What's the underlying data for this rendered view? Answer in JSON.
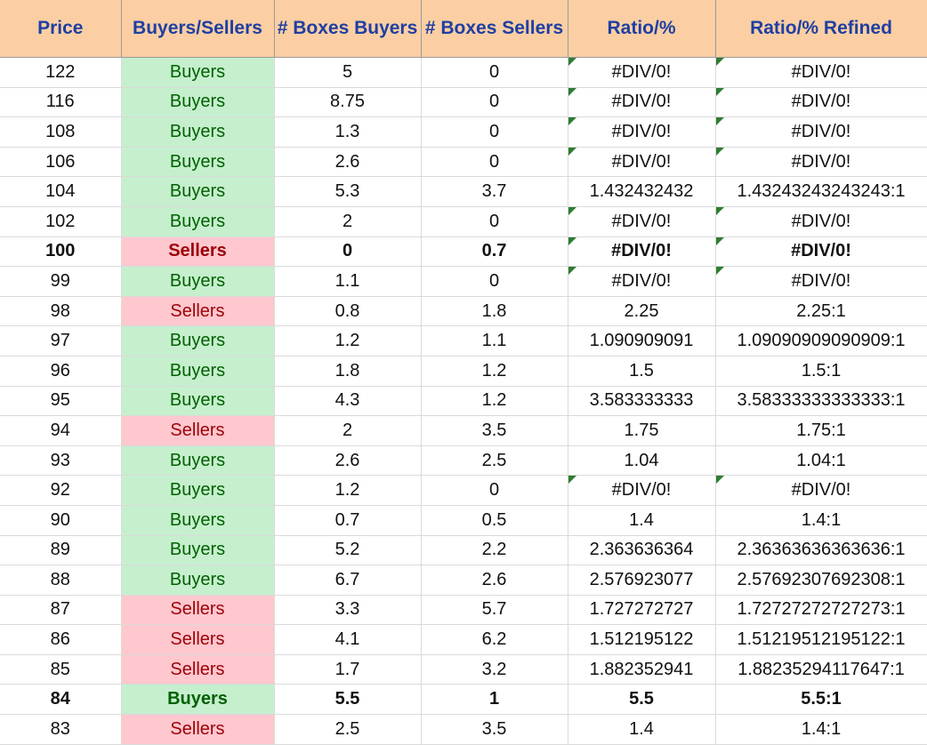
{
  "columns": [
    "Price",
    "Buyers/Sellers",
    "# Boxes Buyers",
    "# Boxes Sellers",
    "Ratio/%",
    "Ratio/% Refined"
  ],
  "colors": {
    "header_bg": "#fbcfa3",
    "header_text": "#1f3fa3",
    "buyers_bg": "#c6efce",
    "buyers_text": "#006100",
    "sellers_bg": "#ffc7ce",
    "sellers_text": "#9c0006"
  },
  "rows": [
    {
      "price": "122",
      "side": "Buyers",
      "buyers": "5",
      "sellers": "0",
      "ratio": "#DIV/0!",
      "refined": "#DIV/0!",
      "err": true
    },
    {
      "price": "116",
      "side": "Buyers",
      "buyers": "8.75",
      "sellers": "0",
      "ratio": "#DIV/0!",
      "refined": "#DIV/0!",
      "err": true
    },
    {
      "price": "108",
      "side": "Buyers",
      "buyers": "1.3",
      "sellers": "0",
      "ratio": "#DIV/0!",
      "refined": "#DIV/0!",
      "err": true
    },
    {
      "price": "106",
      "side": "Buyers",
      "buyers": "2.6",
      "sellers": "0",
      "ratio": "#DIV/0!",
      "refined": "#DIV/0!",
      "err": true
    },
    {
      "price": "104",
      "side": "Buyers",
      "buyers": "5.3",
      "sellers": "3.7",
      "ratio": "1.432432432",
      "refined": "1.43243243243243:1"
    },
    {
      "price": "102",
      "side": "Buyers",
      "buyers": "2",
      "sellers": "0",
      "ratio": "#DIV/0!",
      "refined": "#DIV/0!",
      "err": true
    },
    {
      "price": "100",
      "side": "Sellers",
      "buyers": "0",
      "sellers": "0.7",
      "ratio": "#DIV/0!",
      "refined": "#DIV/0!",
      "err": true,
      "bold": true
    },
    {
      "price": "99",
      "side": "Buyers",
      "buyers": "1.1",
      "sellers": "0",
      "ratio": "#DIV/0!",
      "refined": "#DIV/0!",
      "err": true
    },
    {
      "price": "98",
      "side": "Sellers",
      "buyers": "0.8",
      "sellers": "1.8",
      "ratio": "2.25",
      "refined": "2.25:1"
    },
    {
      "price": "97",
      "side": "Buyers",
      "buyers": "1.2",
      "sellers": "1.1",
      "ratio": "1.090909091",
      "refined": "1.09090909090909:1"
    },
    {
      "price": "96",
      "side": "Buyers",
      "buyers": "1.8",
      "sellers": "1.2",
      "ratio": "1.5",
      "refined": "1.5:1"
    },
    {
      "price": "95",
      "side": "Buyers",
      "buyers": "4.3",
      "sellers": "1.2",
      "ratio": "3.583333333",
      "refined": "3.58333333333333:1"
    },
    {
      "price": "94",
      "side": "Sellers",
      "buyers": "2",
      "sellers": "3.5",
      "ratio": "1.75",
      "refined": "1.75:1"
    },
    {
      "price": "93",
      "side": "Buyers",
      "buyers": "2.6",
      "sellers": "2.5",
      "ratio": "1.04",
      "refined": "1.04:1"
    },
    {
      "price": "92",
      "side": "Buyers",
      "buyers": "1.2",
      "sellers": "0",
      "ratio": "#DIV/0!",
      "refined": "#DIV/0!",
      "err": true
    },
    {
      "price": "90",
      "side": "Buyers",
      "buyers": "0.7",
      "sellers": "0.5",
      "ratio": "1.4",
      "refined": "1.4:1"
    },
    {
      "price": "89",
      "side": "Buyers",
      "buyers": "5.2",
      "sellers": "2.2",
      "ratio": "2.363636364",
      "refined": "2.36363636363636:1"
    },
    {
      "price": "88",
      "side": "Buyers",
      "buyers": "6.7",
      "sellers": "2.6",
      "ratio": "2.576923077",
      "refined": "2.57692307692308:1"
    },
    {
      "price": "87",
      "side": "Sellers",
      "buyers": "3.3",
      "sellers": "5.7",
      "ratio": "1.727272727",
      "refined": "1.72727272727273:1"
    },
    {
      "price": "86",
      "side": "Sellers",
      "buyers": "4.1",
      "sellers": "6.2",
      "ratio": "1.512195122",
      "refined": "1.51219512195122:1"
    },
    {
      "price": "85",
      "side": "Sellers",
      "buyers": "1.7",
      "sellers": "3.2",
      "ratio": "1.882352941",
      "refined": "1.88235294117647:1"
    },
    {
      "price": "84",
      "side": "Buyers",
      "buyers": "5.5",
      "sellers": "1",
      "ratio": "5.5",
      "refined": "5.5:1",
      "bold": true
    },
    {
      "price": "83",
      "side": "Sellers",
      "buyers": "2.5",
      "sellers": "3.5",
      "ratio": "1.4",
      "refined": "1.4:1"
    }
  ]
}
